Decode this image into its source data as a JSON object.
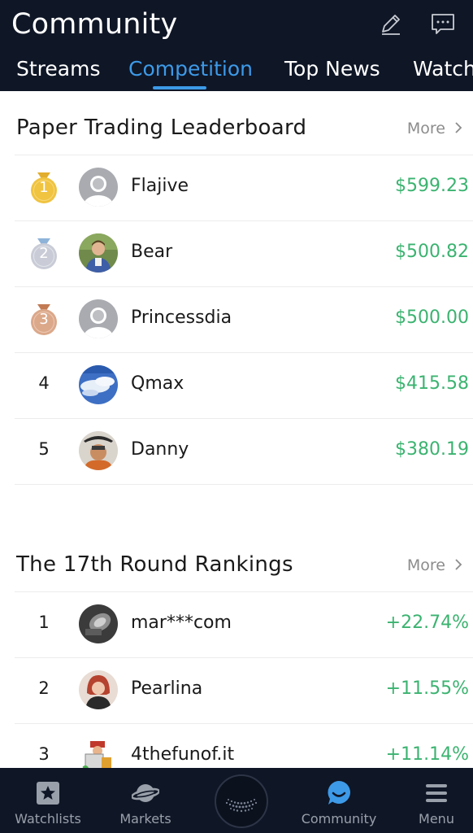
{
  "header": {
    "title": "Community",
    "icons": [
      "edit-icon",
      "message-icon"
    ]
  },
  "tabs": [
    {
      "label": "Streams",
      "active": false
    },
    {
      "label": "Competition",
      "active": true
    },
    {
      "label": "Top News",
      "active": false
    },
    {
      "label": "Watch",
      "active": false
    }
  ],
  "leaderboard": {
    "title": "Paper Trading Leaderboard",
    "more": "More",
    "rows": [
      {
        "rank": "1",
        "medal": "gold",
        "name": "Flajive",
        "value": "$599.23"
      },
      {
        "rank": "2",
        "medal": "silver",
        "name": "Bear",
        "value": "$500.82"
      },
      {
        "rank": "3",
        "medal": "bronze",
        "name": "Princessdia",
        "value": "$500.00"
      },
      {
        "rank": "4",
        "name": "Qmax",
        "value": "$415.58"
      },
      {
        "rank": "5",
        "name": "Danny",
        "value": "$380.19"
      }
    ]
  },
  "round": {
    "title": "The 17th Round Rankings",
    "more": "More",
    "rows": [
      {
        "rank": "1",
        "name": "mar***com",
        "value": "+22.74%"
      },
      {
        "rank": "2",
        "name": "Pearlina",
        "value": "+11.55%"
      },
      {
        "rank": "3",
        "name": "4thefunof.it",
        "value": "+11.14%"
      }
    ]
  },
  "bottom_nav": [
    {
      "label": "Watchlists",
      "icon": "star-icon",
      "active": false
    },
    {
      "label": "Markets",
      "icon": "planet-icon",
      "active": false
    },
    {
      "label": "",
      "icon": "center-logo-icon",
      "active": false
    },
    {
      "label": "Community",
      "icon": "community-icon",
      "active": true
    },
    {
      "label": "Menu",
      "icon": "menu-icon",
      "active": false
    }
  ],
  "colors": {
    "header_bg": "#0f1626",
    "accent": "#3d9ae8",
    "positive": "#3bb370",
    "gold": "#f0c340",
    "silver": "#c9ccd6",
    "bronze": "#dba88a"
  }
}
